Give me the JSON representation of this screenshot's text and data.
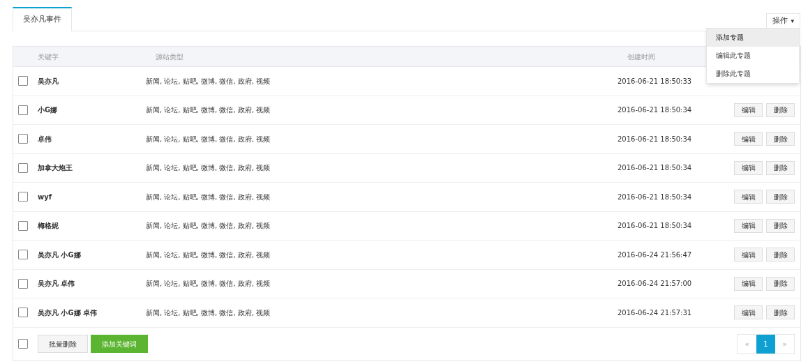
{
  "tabs": [
    {
      "label": "吴亦凡事件",
      "selected": true
    }
  ],
  "actions_button": {
    "label": "操作",
    "caret": "▾"
  },
  "actions_menu": {
    "items": [
      {
        "label": "添加专题",
        "selected": true
      },
      {
        "label": "编辑此专题",
        "selected": false
      },
      {
        "label": "删除此专题",
        "selected": false
      }
    ]
  },
  "table": {
    "columns": [
      "关键字",
      "源站类型",
      "创建时间"
    ],
    "rows": [
      {
        "keyword": "吴亦凡",
        "sources": "新闻, 论坛, 贴吧, 微博, 微信, 政府, 视频",
        "created": "2016-06-21 18:50:33",
        "checked": false
      },
      {
        "keyword": "小G娜",
        "sources": "新闻, 论坛, 贴吧, 微博, 微信, 政府, 视频",
        "created": "2016-06-21 18:50:34",
        "checked": false,
        "actions": [
          "编辑",
          "删除"
        ]
      },
      {
        "keyword": "卓伟",
        "sources": "新闻, 论坛, 贴吧, 微博, 微信, 政府, 视频",
        "created": "2016-06-21 18:50:34",
        "checked": false,
        "actions": [
          "编辑",
          "删除"
        ]
      },
      {
        "keyword": "加拿大炮王",
        "sources": "新闻, 论坛, 贴吧, 微博, 微信, 政府, 视频",
        "created": "2016-06-21 18:50:34",
        "checked": false,
        "actions": [
          "编辑",
          "删除"
        ]
      },
      {
        "keyword": "wyf",
        "sources": "新闻, 论坛, 贴吧, 微博, 微信, 政府, 视频",
        "created": "2016-06-21 18:50:34",
        "checked": false,
        "actions": [
          "编辑",
          "删除"
        ]
      },
      {
        "keyword": "梅格妮",
        "sources": "新闻, 论坛, 贴吧, 微博, 微信, 政府, 视频",
        "created": "2016-06-21 18:50:34",
        "checked": false,
        "actions": [
          "编辑",
          "删除"
        ]
      },
      {
        "keyword": "吴亦凡 小G娜",
        "sources": "新闻, 论坛, 贴吧, 微博, 微信, 政府, 视频",
        "created": "2016-06-24 21:56:47",
        "checked": false,
        "actions": [
          "编辑",
          "删除"
        ]
      },
      {
        "keyword": "吴亦凡 卓伟",
        "sources": "新闻, 论坛, 贴吧, 微博, 微信, 政府, 视频",
        "created": "2016-06-24 21:57:00",
        "checked": false,
        "actions": [
          "编辑",
          "删除"
        ]
      },
      {
        "keyword": "吴亦凡 小G娜 卓伟",
        "sources": "新闻, 论坛, 贴吧, 微博, 微信, 政府, 视频",
        "created": "2016-06-24 21:57:31",
        "checked": false,
        "actions": [
          "编辑",
          "删除"
        ]
      }
    ]
  },
  "footer": {
    "select_all_checked": false,
    "buttons": [
      {
        "label": "批量删除",
        "kind": "default"
      },
      {
        "label": "添加关键词",
        "kind": "primary"
      }
    ],
    "pagination": [
      {
        "label": "«",
        "selected": false
      },
      {
        "label": "1",
        "selected": true
      },
      {
        "label": "»",
        "selected": false
      }
    ]
  }
}
